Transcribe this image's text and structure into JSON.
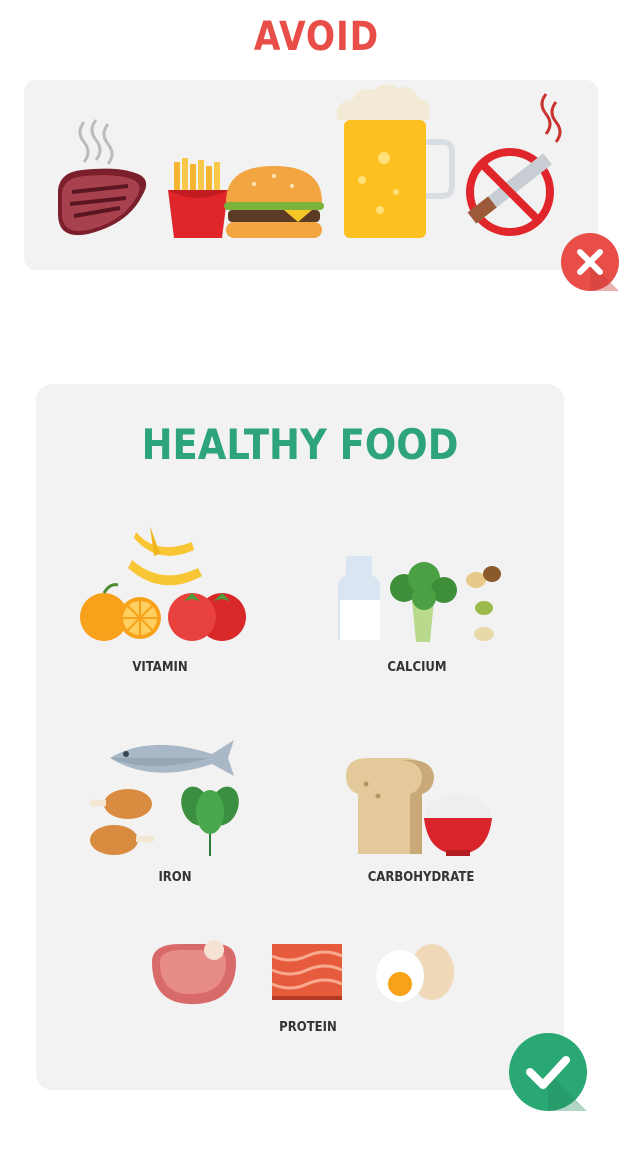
{
  "avoid": {
    "title": "AVOID",
    "items": [
      "steak-icon",
      "french-fries-icon",
      "burger-icon",
      "beer-mug-icon",
      "no-smoking-icon"
    ],
    "badge_icon": "close-icon",
    "title_color": "#e84d47",
    "badge_color": "#e84d47"
  },
  "healthy": {
    "title": "HEALTHY FOOD",
    "title_color": "#2ea47a",
    "badge_icon": "check-icon",
    "badge_color": "#2aa873",
    "groups": [
      {
        "label": "VITAMIN",
        "icons": [
          "banana-icon",
          "orange-icon",
          "tomato-icon"
        ]
      },
      {
        "label": "CALCIUM",
        "icons": [
          "milk-bottle-icon",
          "broccoli-icon",
          "nuts-icon"
        ]
      },
      {
        "label": "IRON",
        "icons": [
          "fish-icon",
          "chicken-leg-icon",
          "spinach-icon"
        ]
      },
      {
        "label": "CARBOHYDRATE",
        "icons": [
          "bread-icon",
          "rice-bowl-icon"
        ]
      },
      {
        "label": "PROTEIN",
        "icons": [
          "meat-icon",
          "salmon-icon",
          "egg-icon"
        ]
      }
    ]
  }
}
